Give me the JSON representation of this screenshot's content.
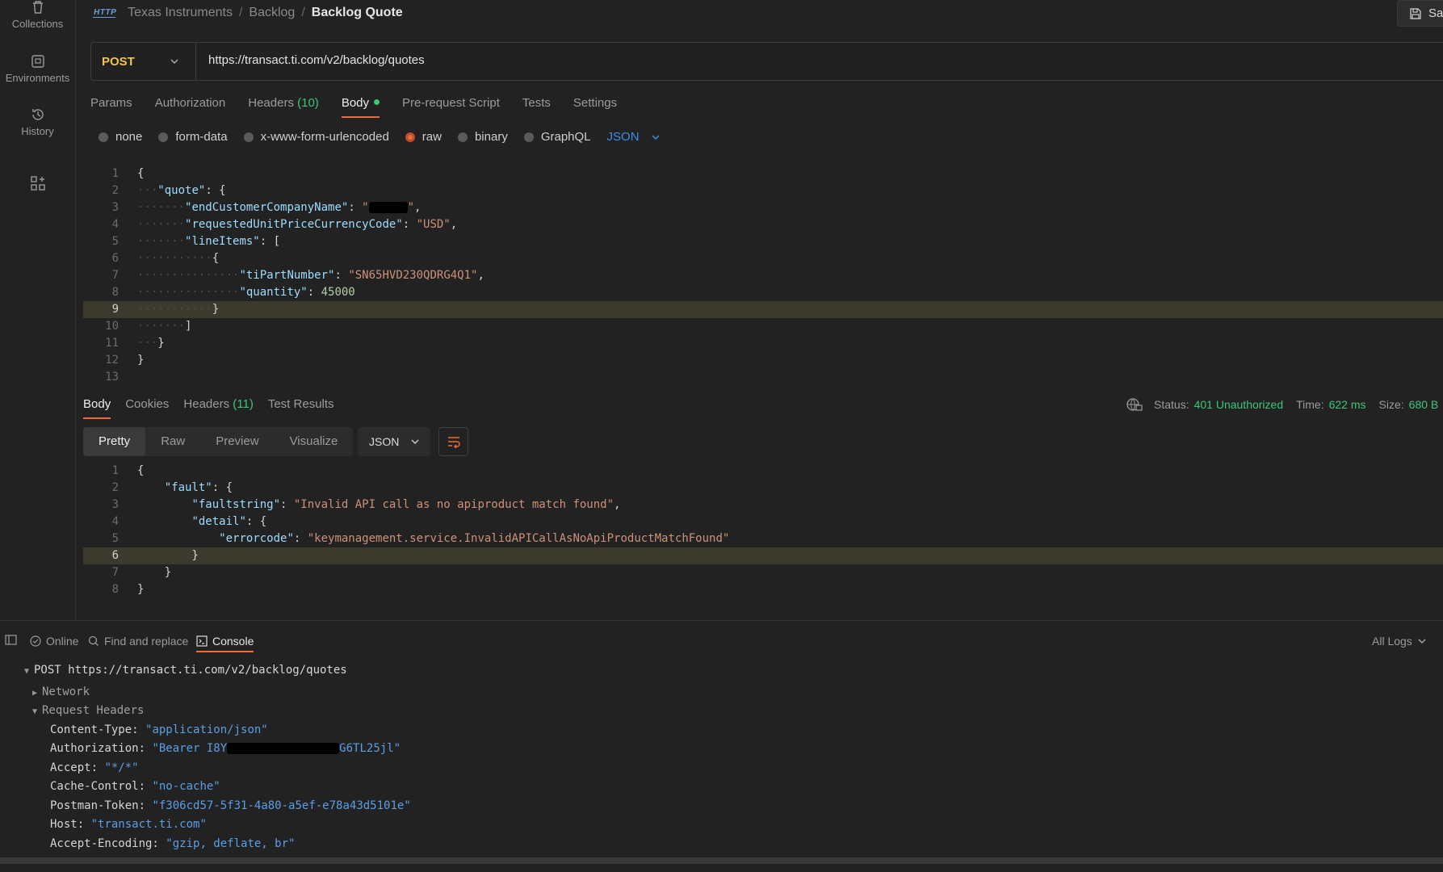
{
  "sidebar": {
    "items": [
      {
        "label": "Collections",
        "icon": "trash-icon"
      },
      {
        "label": "Environments",
        "icon": "environment-icon"
      },
      {
        "label": "History",
        "icon": "history-icon"
      },
      {
        "label": "",
        "icon": "add-apps-icon"
      }
    ]
  },
  "breadcrumb": {
    "badge": "HTTP",
    "parts": [
      "Texas Instruments",
      "Backlog"
    ],
    "current": "Backlog Quote"
  },
  "save_button": {
    "label": "Sa"
  },
  "request": {
    "method": "POST",
    "url": "https://transact.ti.com/v2/backlog/quotes",
    "method_color": "#f0c54a",
    "tabs": {
      "params": "Params",
      "authorization": "Authorization",
      "headers": "Headers",
      "headers_count": "(10)",
      "body": "Body",
      "prerequest": "Pre-request Script",
      "tests": "Tests",
      "settings": "Settings"
    },
    "body_types": {
      "none": "none",
      "form_data": "form-data",
      "urlencoded": "x-www-form-urlencoded",
      "raw": "raw",
      "binary": "binary",
      "graphql": "GraphQL"
    },
    "body_format": "JSON",
    "line_numbers": [
      "1",
      "2",
      "3",
      "4",
      "5",
      "6",
      "7",
      "8",
      "9",
      "10",
      "11",
      "12",
      "13"
    ],
    "body": {
      "key_quote": "\"quote\"",
      "key_company": "\"endCustomerCompanyName\"",
      "key_currency": "\"requestedUnitPriceCurrencyCode\"",
      "val_currency": "\"USD\"",
      "key_lineitems": "\"lineItems\"",
      "key_part": "\"tiPartNumber\"",
      "val_part": "\"SN65HVD230QDRG4Q1\"",
      "key_qty": "\"quantity\"",
      "val_qty": "45000"
    }
  },
  "response": {
    "tabs": {
      "body": "Body",
      "cookies": "Cookies",
      "headers": "Headers",
      "headers_count": "(11)",
      "test_results": "Test Results"
    },
    "status_label": "Status:",
    "status_value": "401 Unauthorized",
    "time_label": "Time:",
    "time_value": "622 ms",
    "size_label": "Size:",
    "size_value": "680 B",
    "views": {
      "pretty": "Pretty",
      "raw": "Raw",
      "preview": "Preview",
      "visualize": "Visualize"
    },
    "format": "JSON",
    "line_numbers": [
      "1",
      "2",
      "3",
      "4",
      "5",
      "6",
      "7",
      "8"
    ],
    "body": {
      "key_fault": "\"fault\"",
      "key_faultstring": "\"faultstring\"",
      "val_faultstring": "\"Invalid API call as no apiproduct match found\"",
      "key_detail": "\"detail\"",
      "key_errorcode": "\"errorcode\"",
      "val_errorcode": "\"keymanagement.service.InvalidAPICallAsNoApiProductMatchFound\""
    }
  },
  "bottombar": {
    "online": "Online",
    "find_replace": "Find and replace",
    "console": "Console",
    "all_logs": "All Logs"
  },
  "console": {
    "request_line": "POST https://transact.ti.com/v2/backlog/quotes",
    "network": "Network",
    "request_headers": "Request Headers",
    "headers": [
      {
        "name": "Content-Type:",
        "value": "\"application/json\""
      },
      {
        "name": "Authorization:",
        "value_start": "\"Bearer I8Y",
        "value_end": "G6TL25jl\""
      },
      {
        "name": "Accept:",
        "value": "\"*/*\""
      },
      {
        "name": "Cache-Control:",
        "value": "\"no-cache\""
      },
      {
        "name": "Postman-Token:",
        "value": "\"f306cd57-5f31-4a80-a5ef-e78a43d5101e\""
      },
      {
        "name": "Host:",
        "value": "\"transact.ti.com\""
      },
      {
        "name": "Accept-Encoding:",
        "value": "\"gzip, deflate, br\""
      }
    ]
  }
}
